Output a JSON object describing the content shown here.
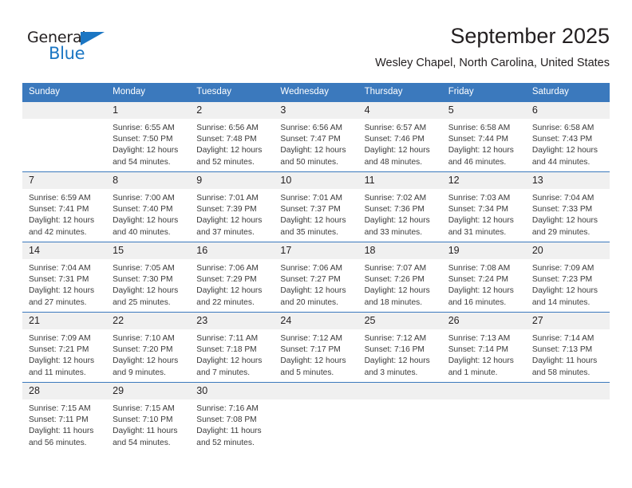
{
  "brand": {
    "name_top": "General",
    "name_bottom": "Blue",
    "triangle_color": "#1b76c3"
  },
  "header": {
    "month_title": "September 2025",
    "location": "Wesley Chapel, North Carolina, United States"
  },
  "colors": {
    "header_blue": "#3b79bd",
    "daynum_band": "#f0f0f0",
    "text": "#231f20",
    "cell_text": "#3a3a3a"
  },
  "calendar": {
    "weekday_headers": [
      "Sunday",
      "Monday",
      "Tuesday",
      "Wednesday",
      "Thursday",
      "Friday",
      "Saturday"
    ],
    "weeks": [
      [
        {
          "day": "",
          "sunrise": "",
          "sunset": "",
          "daylight": ""
        },
        {
          "day": "1",
          "sunrise": "Sunrise: 6:55 AM",
          "sunset": "Sunset: 7:50 PM",
          "daylight": "Daylight: 12 hours and 54 minutes."
        },
        {
          "day": "2",
          "sunrise": "Sunrise: 6:56 AM",
          "sunset": "Sunset: 7:48 PM",
          "daylight": "Daylight: 12 hours and 52 minutes."
        },
        {
          "day": "3",
          "sunrise": "Sunrise: 6:56 AM",
          "sunset": "Sunset: 7:47 PM",
          "daylight": "Daylight: 12 hours and 50 minutes."
        },
        {
          "day": "4",
          "sunrise": "Sunrise: 6:57 AM",
          "sunset": "Sunset: 7:46 PM",
          "daylight": "Daylight: 12 hours and 48 minutes."
        },
        {
          "day": "5",
          "sunrise": "Sunrise: 6:58 AM",
          "sunset": "Sunset: 7:44 PM",
          "daylight": "Daylight: 12 hours and 46 minutes."
        },
        {
          "day": "6",
          "sunrise": "Sunrise: 6:58 AM",
          "sunset": "Sunset: 7:43 PM",
          "daylight": "Daylight: 12 hours and 44 minutes."
        }
      ],
      [
        {
          "day": "7",
          "sunrise": "Sunrise: 6:59 AM",
          "sunset": "Sunset: 7:41 PM",
          "daylight": "Daylight: 12 hours and 42 minutes."
        },
        {
          "day": "8",
          "sunrise": "Sunrise: 7:00 AM",
          "sunset": "Sunset: 7:40 PM",
          "daylight": "Daylight: 12 hours and 40 minutes."
        },
        {
          "day": "9",
          "sunrise": "Sunrise: 7:01 AM",
          "sunset": "Sunset: 7:39 PM",
          "daylight": "Daylight: 12 hours and 37 minutes."
        },
        {
          "day": "10",
          "sunrise": "Sunrise: 7:01 AM",
          "sunset": "Sunset: 7:37 PM",
          "daylight": "Daylight: 12 hours and 35 minutes."
        },
        {
          "day": "11",
          "sunrise": "Sunrise: 7:02 AM",
          "sunset": "Sunset: 7:36 PM",
          "daylight": "Daylight: 12 hours and 33 minutes."
        },
        {
          "day": "12",
          "sunrise": "Sunrise: 7:03 AM",
          "sunset": "Sunset: 7:34 PM",
          "daylight": "Daylight: 12 hours and 31 minutes."
        },
        {
          "day": "13",
          "sunrise": "Sunrise: 7:04 AM",
          "sunset": "Sunset: 7:33 PM",
          "daylight": "Daylight: 12 hours and 29 minutes."
        }
      ],
      [
        {
          "day": "14",
          "sunrise": "Sunrise: 7:04 AM",
          "sunset": "Sunset: 7:31 PM",
          "daylight": "Daylight: 12 hours and 27 minutes."
        },
        {
          "day": "15",
          "sunrise": "Sunrise: 7:05 AM",
          "sunset": "Sunset: 7:30 PM",
          "daylight": "Daylight: 12 hours and 25 minutes."
        },
        {
          "day": "16",
          "sunrise": "Sunrise: 7:06 AM",
          "sunset": "Sunset: 7:29 PM",
          "daylight": "Daylight: 12 hours and 22 minutes."
        },
        {
          "day": "17",
          "sunrise": "Sunrise: 7:06 AM",
          "sunset": "Sunset: 7:27 PM",
          "daylight": "Daylight: 12 hours and 20 minutes."
        },
        {
          "day": "18",
          "sunrise": "Sunrise: 7:07 AM",
          "sunset": "Sunset: 7:26 PM",
          "daylight": "Daylight: 12 hours and 18 minutes."
        },
        {
          "day": "19",
          "sunrise": "Sunrise: 7:08 AM",
          "sunset": "Sunset: 7:24 PM",
          "daylight": "Daylight: 12 hours and 16 minutes."
        },
        {
          "day": "20",
          "sunrise": "Sunrise: 7:09 AM",
          "sunset": "Sunset: 7:23 PM",
          "daylight": "Daylight: 12 hours and 14 minutes."
        }
      ],
      [
        {
          "day": "21",
          "sunrise": "Sunrise: 7:09 AM",
          "sunset": "Sunset: 7:21 PM",
          "daylight": "Daylight: 12 hours and 11 minutes."
        },
        {
          "day": "22",
          "sunrise": "Sunrise: 7:10 AM",
          "sunset": "Sunset: 7:20 PM",
          "daylight": "Daylight: 12 hours and 9 minutes."
        },
        {
          "day": "23",
          "sunrise": "Sunrise: 7:11 AM",
          "sunset": "Sunset: 7:18 PM",
          "daylight": "Daylight: 12 hours and 7 minutes."
        },
        {
          "day": "24",
          "sunrise": "Sunrise: 7:12 AM",
          "sunset": "Sunset: 7:17 PM",
          "daylight": "Daylight: 12 hours and 5 minutes."
        },
        {
          "day": "25",
          "sunrise": "Sunrise: 7:12 AM",
          "sunset": "Sunset: 7:16 PM",
          "daylight": "Daylight: 12 hours and 3 minutes."
        },
        {
          "day": "26",
          "sunrise": "Sunrise: 7:13 AM",
          "sunset": "Sunset: 7:14 PM",
          "daylight": "Daylight: 12 hours and 1 minute."
        },
        {
          "day": "27",
          "sunrise": "Sunrise: 7:14 AM",
          "sunset": "Sunset: 7:13 PM",
          "daylight": "Daylight: 11 hours and 58 minutes."
        }
      ],
      [
        {
          "day": "28",
          "sunrise": "Sunrise: 7:15 AM",
          "sunset": "Sunset: 7:11 PM",
          "daylight": "Daylight: 11 hours and 56 minutes."
        },
        {
          "day": "29",
          "sunrise": "Sunrise: 7:15 AM",
          "sunset": "Sunset: 7:10 PM",
          "daylight": "Daylight: 11 hours and 54 minutes."
        },
        {
          "day": "30",
          "sunrise": "Sunrise: 7:16 AM",
          "sunset": "Sunset: 7:08 PM",
          "daylight": "Daylight: 11 hours and 52 minutes."
        },
        {
          "day": "",
          "sunrise": "",
          "sunset": "",
          "daylight": ""
        },
        {
          "day": "",
          "sunrise": "",
          "sunset": "",
          "daylight": ""
        },
        {
          "day": "",
          "sunrise": "",
          "sunset": "",
          "daylight": ""
        },
        {
          "day": "",
          "sunrise": "",
          "sunset": "",
          "daylight": ""
        }
      ]
    ]
  }
}
